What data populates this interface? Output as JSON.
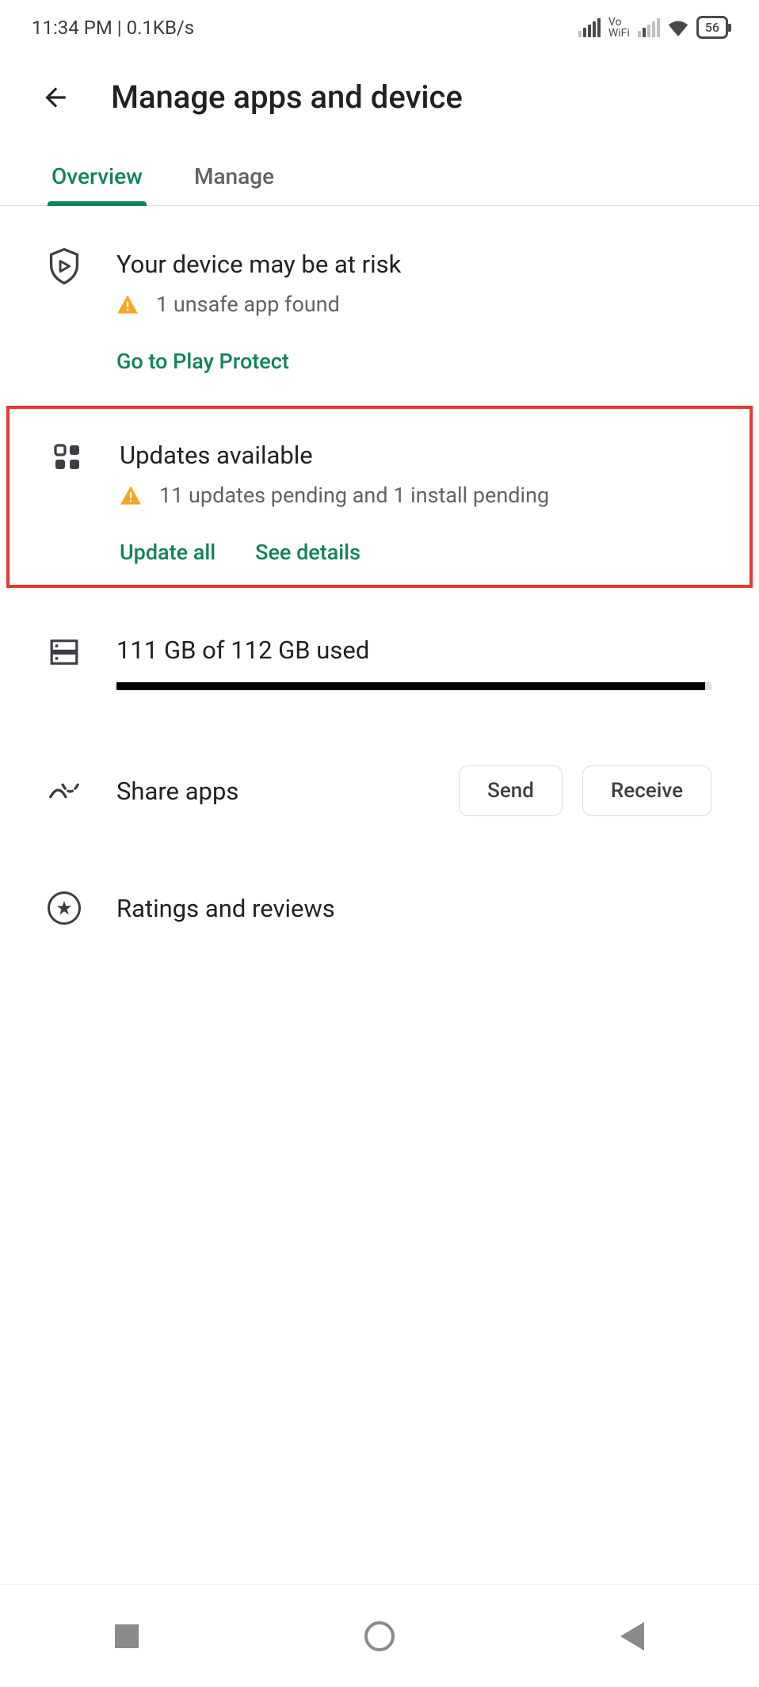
{
  "status": {
    "time": "11:34 PM",
    "speed": "0.1KB/s",
    "vowifi_top": "Vo",
    "vowifi_bottom": "WiFi",
    "battery": "56"
  },
  "header": {
    "title": "Manage apps and device"
  },
  "tabs": {
    "overview": "Overview",
    "manage": "Manage"
  },
  "protect": {
    "title": "Your device may be at risk",
    "subtitle": "1 unsafe app found",
    "action": "Go to Play Protect"
  },
  "updates": {
    "title": "Updates available",
    "subtitle": "11 updates pending and 1 install pending",
    "action_update": "Update all",
    "action_details": "See details"
  },
  "storage": {
    "text": "111 GB of 112 GB used"
  },
  "share": {
    "label": "Share apps",
    "send": "Send",
    "receive": "Receive"
  },
  "ratings": {
    "label": "Ratings and reviews"
  }
}
